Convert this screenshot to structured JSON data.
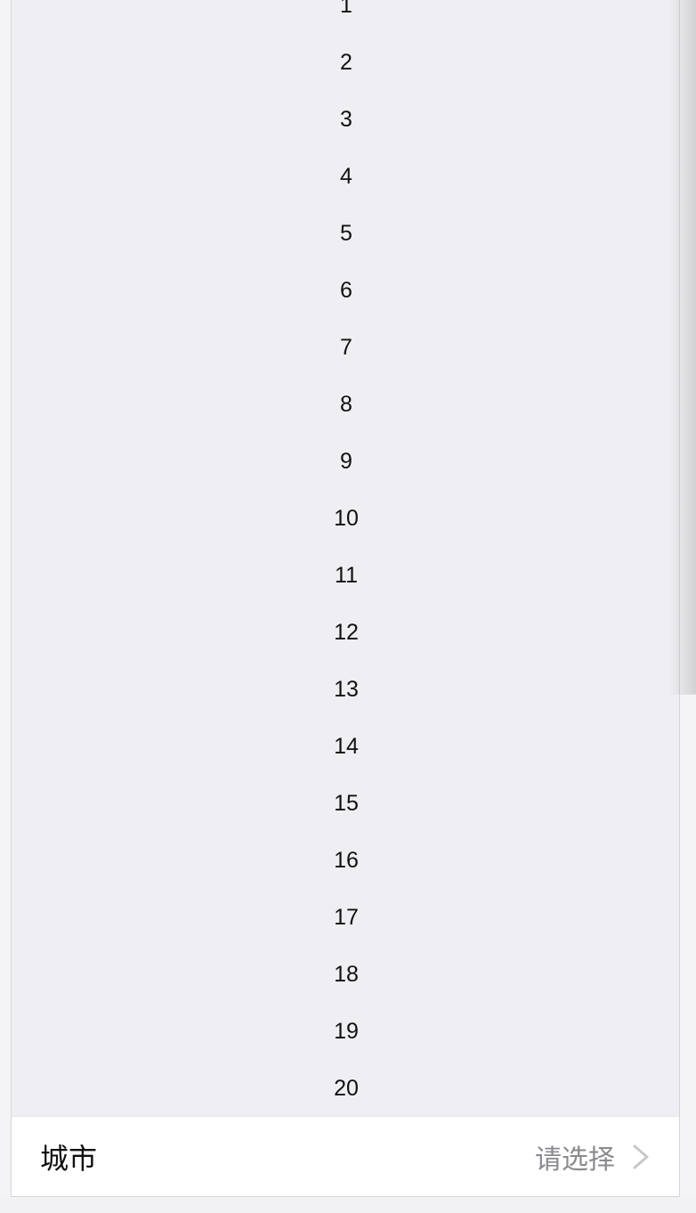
{
  "picker": {
    "items": [
      "1",
      "2",
      "3",
      "4",
      "5",
      "6",
      "7",
      "8",
      "9",
      "10",
      "11",
      "12",
      "13",
      "14",
      "15",
      "16",
      "17",
      "18",
      "19",
      "20"
    ]
  },
  "cell": {
    "label": "城市",
    "value": "请选择",
    "icon": "chevron-right-icon"
  },
  "colors": {
    "background": "#efeff3",
    "text": "#111111",
    "placeholder": "#8a8a8f",
    "chevron": "#c7c7cc"
  }
}
